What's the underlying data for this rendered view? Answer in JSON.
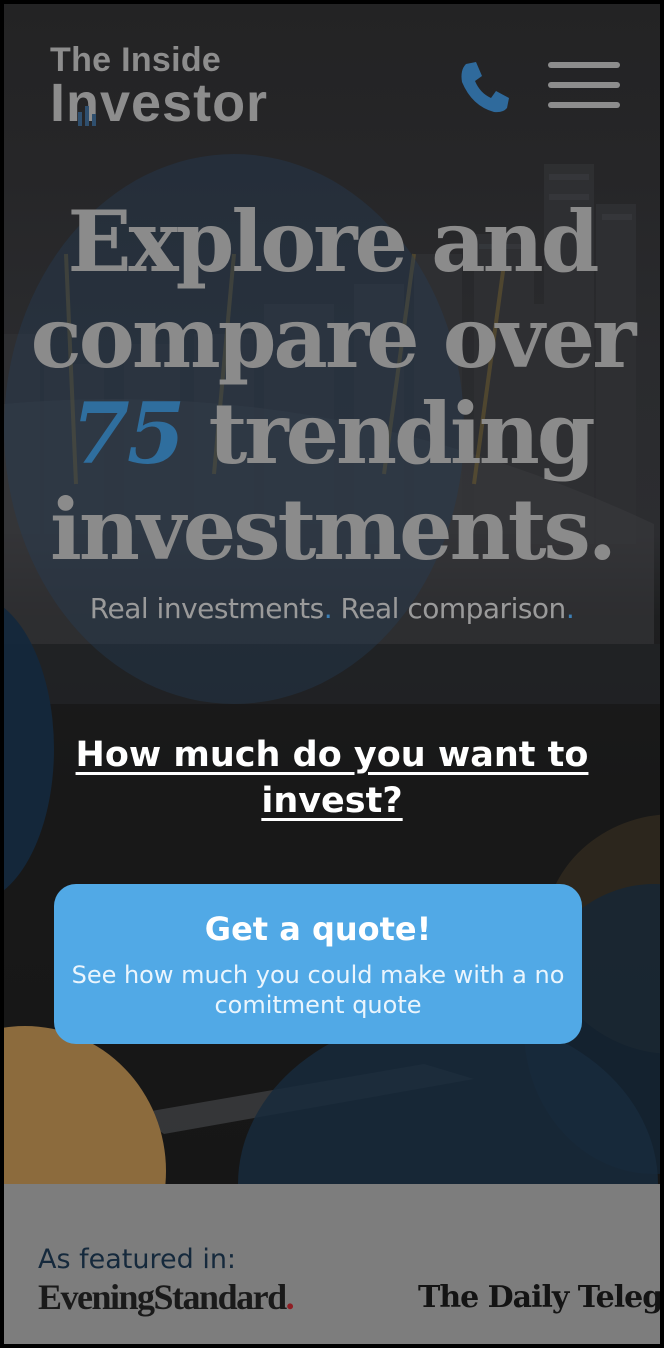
{
  "header": {
    "logo_top": "The Inside",
    "logo_main": "Investor",
    "phone_icon": "phone-icon",
    "menu_icon": "hamburger-menu-icon"
  },
  "hero": {
    "headline_line1": "Explore and",
    "headline_line2": "compare over",
    "headline_number": "75",
    "headline_line3_rest": " trending",
    "headline_line4": "investments.",
    "tagline_part1": "Real investments",
    "tagline_part2": " Real comparison",
    "tagline_dot": "."
  },
  "cta": {
    "question": "How much do you want to invest?",
    "quote_title": "Get a quote!",
    "quote_subtitle": "See how much you could make with a no comitment quote"
  },
  "featured": {
    "label": "As featured in:",
    "logo1": "EveningStandard",
    "logo1_dot": ".",
    "logo2": "The Daily Telegr"
  },
  "colors": {
    "accent_blue": "#51a9e6",
    "number_blue": "#2f6e9e",
    "gold": "#8c6b3d",
    "featured_bg": "#7d7d7d"
  }
}
